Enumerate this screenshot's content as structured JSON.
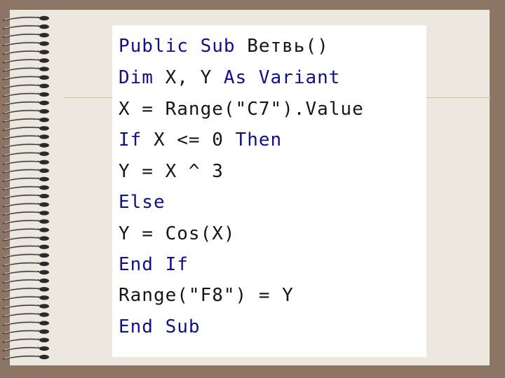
{
  "colors": {
    "keyword": "#101088",
    "plain": "#161616",
    "panel_background": "#ffffff",
    "page_background": "#ece8e0",
    "frame_background": "#8c7565"
  },
  "decorations": {
    "binding": "spiral-binding"
  },
  "code": {
    "lines": [
      {
        "segments": [
          {
            "text": "Public Sub ",
            "kind": "keyword"
          },
          {
            "text": "Ветвь()",
            "kind": "plain"
          }
        ]
      },
      {
        "segments": [
          {
            "text": "Dim ",
            "kind": "keyword"
          },
          {
            "text": "X, Y ",
            "kind": "plain"
          },
          {
            "text": "As Variant",
            "kind": "keyword"
          }
        ]
      },
      {
        "segments": [
          {
            "text": "X = Range(\"C7\").Value",
            "kind": "plain"
          }
        ]
      },
      {
        "segments": [
          {
            "text": "If ",
            "kind": "keyword"
          },
          {
            "text": "X <= 0 ",
            "kind": "plain"
          },
          {
            "text": "Then",
            "kind": "keyword"
          }
        ]
      },
      {
        "segments": [
          {
            "text": "Y = X ^ 3",
            "kind": "plain"
          }
        ]
      },
      {
        "segments": [
          {
            "text": "Else",
            "kind": "keyword"
          }
        ]
      },
      {
        "segments": [
          {
            "text": "Y = Cos(X)",
            "kind": "plain"
          }
        ]
      },
      {
        "segments": [
          {
            "text": "End If",
            "kind": "keyword"
          }
        ]
      },
      {
        "segments": [
          {
            "text": "Range(\"F8\") = Y",
            "kind": "plain"
          }
        ]
      },
      {
        "segments": [
          {
            "text": "End Sub",
            "kind": "keyword"
          }
        ]
      }
    ]
  }
}
